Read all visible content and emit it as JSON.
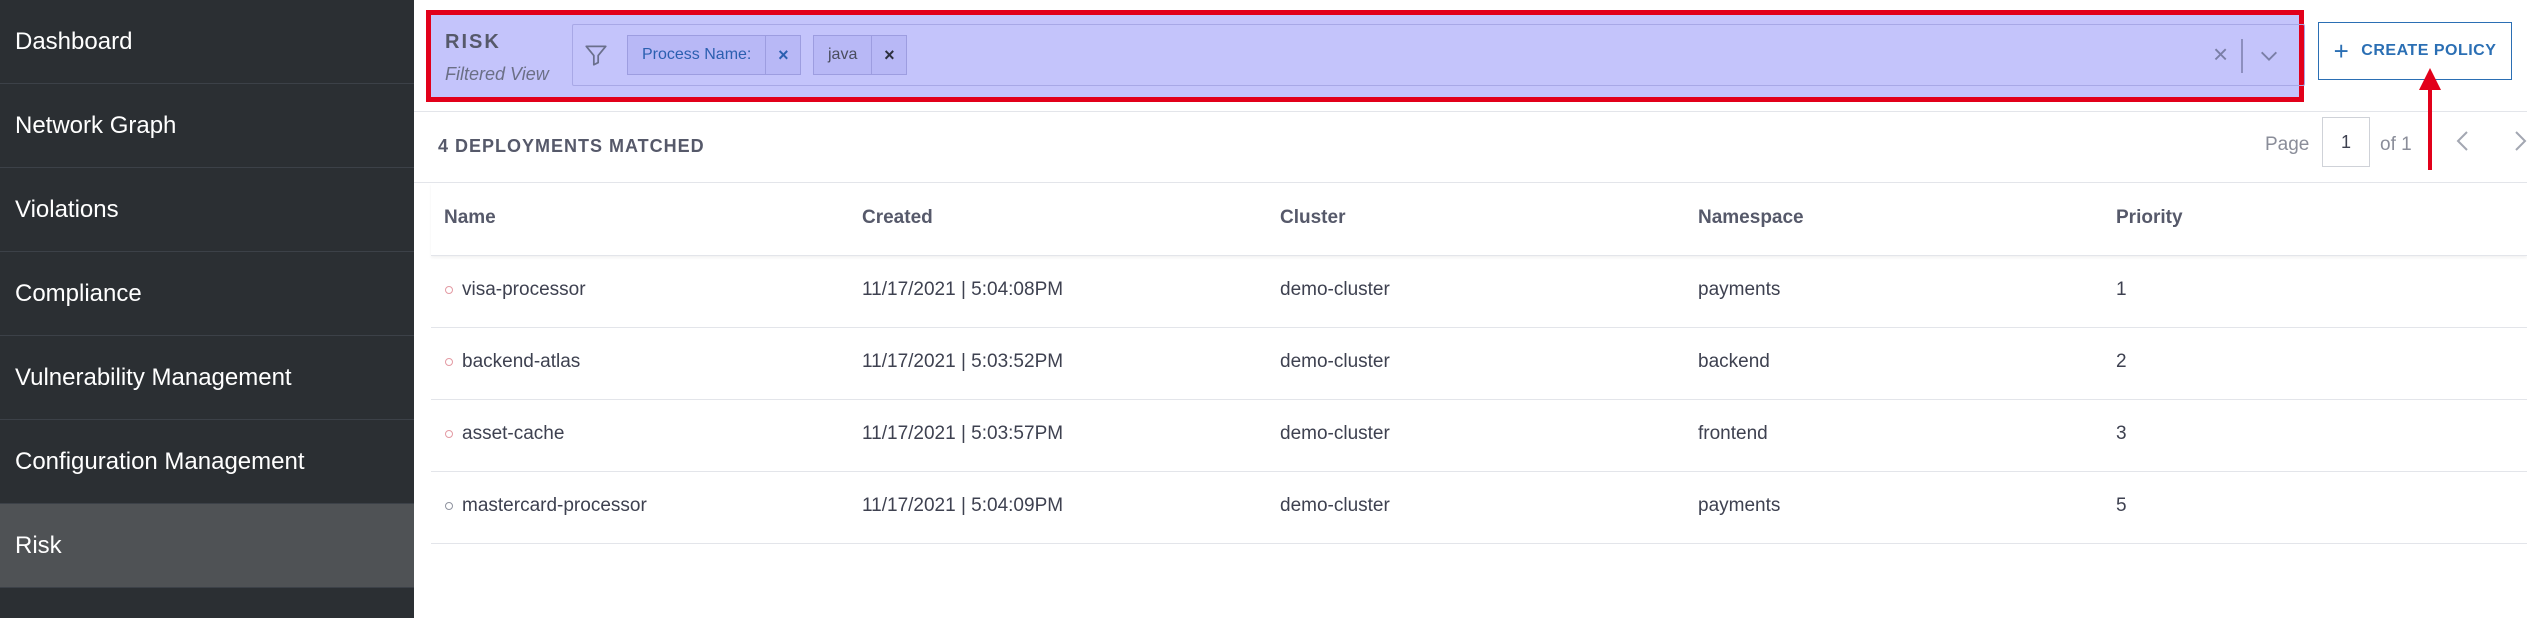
{
  "sidebar": {
    "items": [
      {
        "label": "Dashboard"
      },
      {
        "label": "Network Graph"
      },
      {
        "label": "Violations"
      },
      {
        "label": "Compliance"
      },
      {
        "label": "Vulnerability Management"
      },
      {
        "label": "Configuration Management"
      },
      {
        "label": "Risk"
      }
    ],
    "active": "Risk"
  },
  "header": {
    "title": "RISK",
    "subtitle": "Filtered View",
    "filters": [
      {
        "label": "Process Name:"
      },
      {
        "label": "java"
      }
    ],
    "create_policy_label": "CREATE POLICY"
  },
  "results": {
    "count_label": "4 DEPLOYMENTS MATCHED",
    "pagination": {
      "page_label": "Page",
      "page_value": "1",
      "of_label": "of 1"
    }
  },
  "table": {
    "columns": [
      "Name",
      "Created",
      "Cluster",
      "Namespace",
      "Priority"
    ],
    "rows": [
      {
        "name": "visa-processor",
        "created": "11/17/2021 | 5:04:08PM",
        "cluster": "demo-cluster",
        "namespace": "payments",
        "priority": "1",
        "status": "red"
      },
      {
        "name": "backend-atlas",
        "created": "11/17/2021 | 5:03:52PM",
        "cluster": "demo-cluster",
        "namespace": "backend",
        "priority": "2",
        "status": "red"
      },
      {
        "name": "asset-cache",
        "created": "11/17/2021 | 5:03:57PM",
        "cluster": "demo-cluster",
        "namespace": "frontend",
        "priority": "3",
        "status": "red"
      },
      {
        "name": "mastercard-processor",
        "created": "11/17/2021 | 5:04:09PM",
        "cluster": "demo-cluster",
        "namespace": "payments",
        "priority": "5",
        "status": "grey"
      }
    ]
  },
  "colors": {
    "sidebar_bg": "#2b2f33",
    "active_nav_bg": "#4f5255",
    "filter_highlight": "#c4c4fb",
    "annotation_red": "#e2001a",
    "accent_blue": "#2b6fb4"
  }
}
